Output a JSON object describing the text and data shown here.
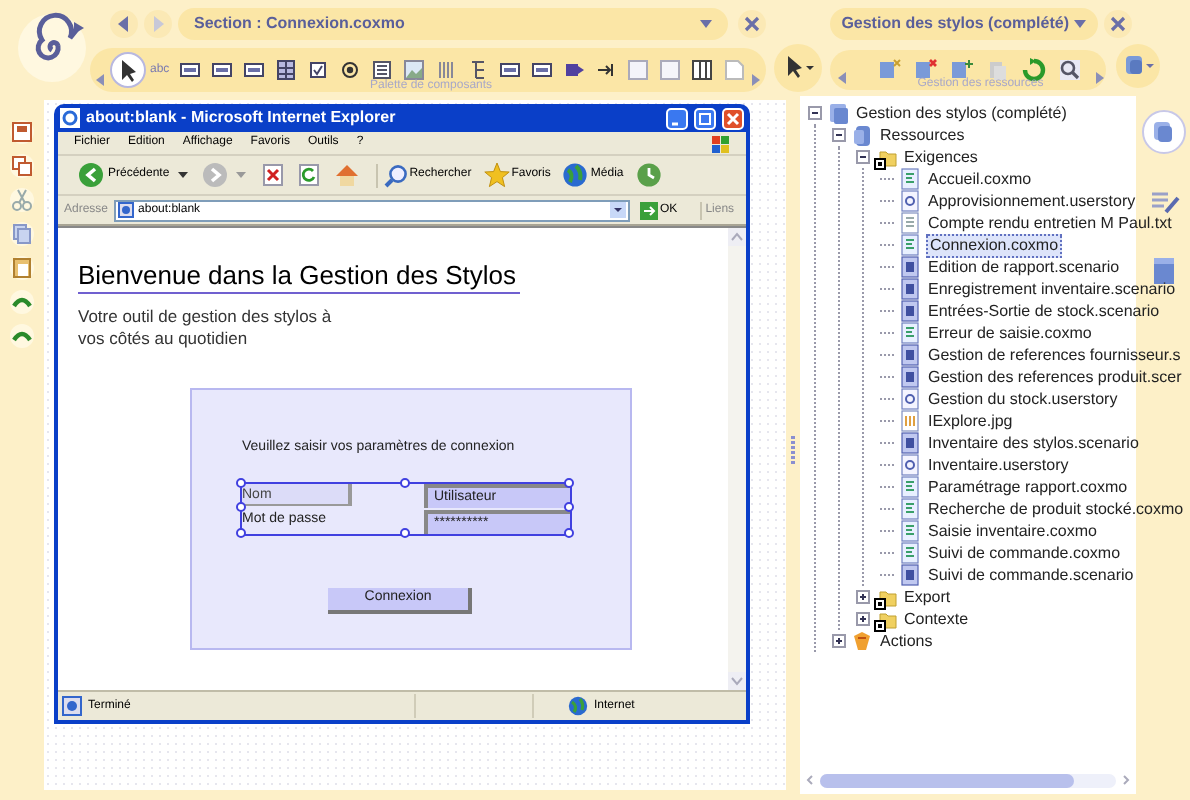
{
  "section_bar": {
    "title": "Section : Connexion.coxmo"
  },
  "palette": {
    "text_tool": "abc",
    "label": "Palette de composants"
  },
  "browser": {
    "title": "about:blank - Microsoft Internet Explorer",
    "menu": [
      "Fichier",
      "Edition",
      "Affichage",
      "Favoris",
      "Outils",
      "?"
    ],
    "toolbar": {
      "back": "Précédente",
      "search": "Rechercher",
      "favorites": "Favoris",
      "media": "Média"
    },
    "address_label": "Adresse",
    "address": "about:blank",
    "go": "OK",
    "links": "Liens",
    "page": {
      "heading": "Bienvenue dans la Gestion des Stylos",
      "subtitle": "Votre outil de gestion des stylos à vos côtés au quotidien",
      "form": {
        "prompt": "Veuillez saisir vos paramètres de connexion",
        "fields": [
          {
            "label": "Nom",
            "value": "Utilisateur"
          },
          {
            "label": "Mot de passe",
            "value": "**********"
          }
        ],
        "button": "Connexion"
      }
    },
    "status": {
      "text": "Terminé",
      "zone": "Internet"
    }
  },
  "resources": {
    "title": "Gestion des stylos (complété)",
    "toolbar_label": "Gestion des ressources",
    "tree": [
      {
        "label": "Gestion des stylos (complété)",
        "kind": "root",
        "expanded": true,
        "selected": false,
        "children": [
          {
            "label": "Ressources",
            "kind": "resources",
            "expanded": true,
            "selected": false,
            "children": [
              {
                "label": "Exigences",
                "kind": "folder",
                "expanded": true,
                "selected": false,
                "children": [
                  {
                    "label": "Accueil.coxmo",
                    "kind": "coxmo",
                    "selected": false
                  },
                  {
                    "label": "Approvisionnement.userstory",
                    "kind": "userstory",
                    "selected": false
                  },
                  {
                    "label": "Compte rendu entretien M Paul.txt",
                    "kind": "txt",
                    "selected": false
                  },
                  {
                    "label": "Connexion.coxmo",
                    "kind": "coxmo",
                    "selected": true
                  },
                  {
                    "label": "Edition de rapport.scenario",
                    "kind": "scenario",
                    "selected": false
                  },
                  {
                    "label": "Enregistrement inventaire.scenario",
                    "kind": "scenario",
                    "selected": false
                  },
                  {
                    "label": "Entrées-Sortie de stock.scenario",
                    "kind": "scenario",
                    "selected": false
                  },
                  {
                    "label": "Erreur de saisie.coxmo",
                    "kind": "coxmo",
                    "selected": false
                  },
                  {
                    "label": "Gestion de references fournisseur.s",
                    "kind": "scenario",
                    "selected": false
                  },
                  {
                    "label": "Gestion des references produit.scer",
                    "kind": "scenario",
                    "selected": false
                  },
                  {
                    "label": "Gestion du stock.userstory",
                    "kind": "userstory",
                    "selected": false
                  },
                  {
                    "label": "IExplore.jpg",
                    "kind": "jpg",
                    "selected": false
                  },
                  {
                    "label": "Inventaire des stylos.scenario",
                    "kind": "scenario",
                    "selected": false
                  },
                  {
                    "label": "Inventaire.userstory",
                    "kind": "userstory",
                    "selected": false
                  },
                  {
                    "label": "Paramétrage rapport.coxmo",
                    "kind": "coxmo",
                    "selected": false
                  },
                  {
                    "label": "Recherche de produit stocké.coxmo",
                    "kind": "coxmo",
                    "selected": false
                  },
                  {
                    "label": "Saisie inventaire.coxmo",
                    "kind": "coxmo",
                    "selected": false
                  },
                  {
                    "label": "Suivi de commande.coxmo",
                    "kind": "coxmo",
                    "selected": false
                  },
                  {
                    "label": "Suivi de commande.scenario",
                    "kind": "scenario",
                    "selected": false
                  }
                ]
              },
              {
                "label": "Export",
                "kind": "folder",
                "expanded": false,
                "selected": false
              },
              {
                "label": "Contexte",
                "kind": "folder",
                "expanded": false,
                "selected": false
              }
            ]
          },
          {
            "label": "Actions",
            "kind": "actions",
            "expanded": false,
            "selected": false
          }
        ]
      }
    ]
  }
}
